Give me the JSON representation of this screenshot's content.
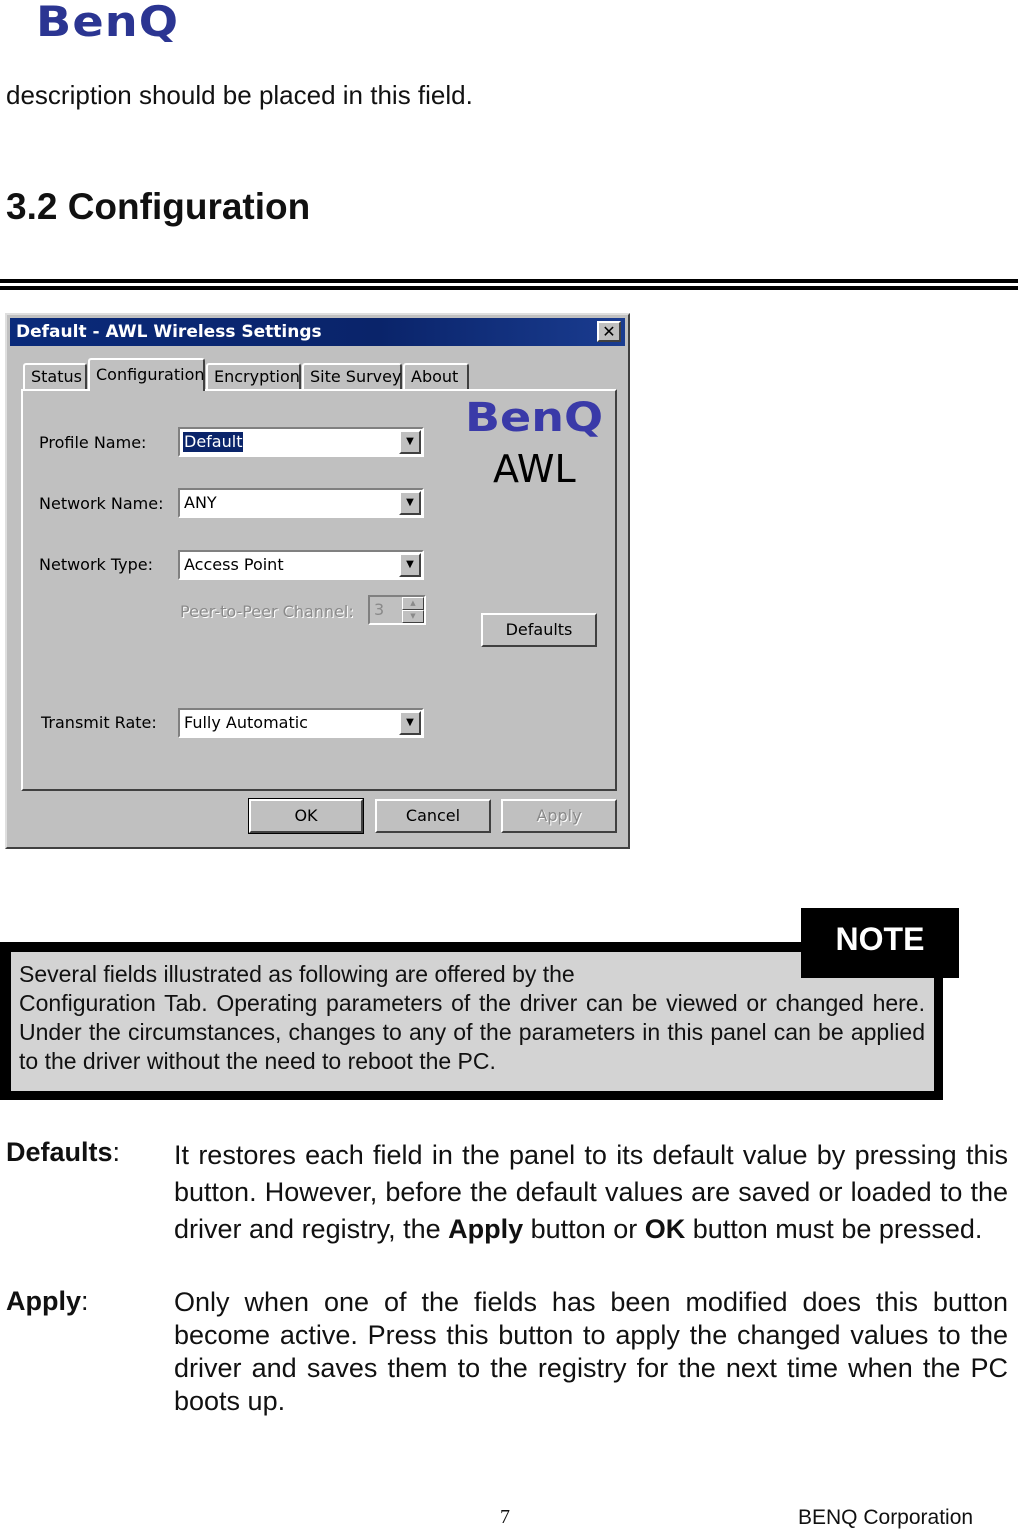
{
  "header": {
    "logo_text": "BenQ"
  },
  "intro_text": "description should be placed in this field.",
  "section_title": "3.2 Configuration",
  "dialog": {
    "title": "Default - AWL Wireless Settings",
    "close_glyph": "✕",
    "tabs": [
      "Status",
      "Configuration",
      "Encryption",
      "Site Survey",
      "About"
    ],
    "active_tab": "Configuration",
    "fields": {
      "profile_name": {
        "label": "Profile Name:",
        "value": "Default"
      },
      "network_name": {
        "label": "Network Name:",
        "value": "ANY"
      },
      "network_type": {
        "label": "Network Type:",
        "value": "Access Point"
      },
      "peer_channel": {
        "label": "Peer-to-Peer Channel:",
        "value": "3"
      },
      "transmit_rate": {
        "label": "Transmit Rate:",
        "value": "Fully Automatic"
      }
    },
    "brand": {
      "logo": "BenQ",
      "product": "AWL"
    },
    "buttons": {
      "defaults": "Defaults",
      "ok": "OK",
      "cancel": "Cancel",
      "apply": "Apply"
    }
  },
  "note": {
    "tag": "NOTE",
    "line1": "Several fields illustrated as following are offered by the",
    "body": "Configuration Tab. Operating parameters of the driver can be viewed or changed here. Under the circumstances, changes to any of the parameters in this panel can be applied to the driver without the need to reboot the PC."
  },
  "definitions": [
    {
      "term": "Defaults",
      "sep": ":",
      "text_a": "It restores each field in the panel to its default value by pressing this button. However, before the default values are saved or loaded to the driver and registry, the ",
      "bold1": "Apply",
      "text_b": " button or ",
      "bold2": "OK",
      "text_c": " button must be pressed."
    },
    {
      "term": "Apply",
      "sep": ":",
      "text": "Only when one of the fields has been modified does this button become active. Press this button to apply the changed values to the driver and saves them to the registry for the next time when the PC boots up."
    }
  ],
  "footer": {
    "page_number": "7",
    "company": "BENQ Corporation"
  }
}
